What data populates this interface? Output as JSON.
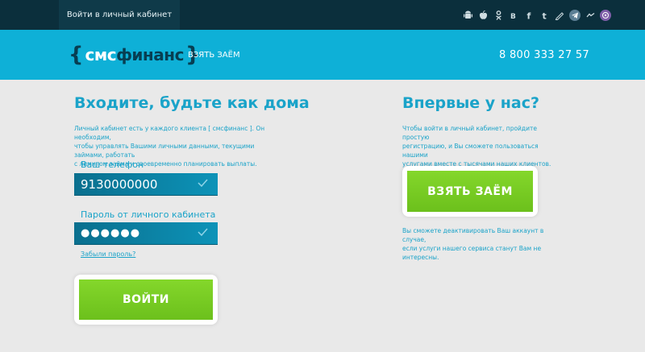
{
  "topbar": {
    "login_tab": "Войти в личный кабинет",
    "social": [
      {
        "name": "android-icon",
        "glyph": "🤖"
      },
      {
        "name": "apple-icon",
        "glyph": ""
      },
      {
        "name": "odnoklassniki-icon",
        "glyph": "ok"
      },
      {
        "name": "vk-icon",
        "glyph": "B"
      },
      {
        "name": "facebook-icon",
        "glyph": "f"
      },
      {
        "name": "twitter-icon",
        "glyph": "t"
      },
      {
        "name": "paperclip-icon",
        "glyph": "✎"
      },
      {
        "name": "telegram-icon",
        "glyph": "➤"
      },
      {
        "name": "messenger-icon",
        "glyph": "~"
      },
      {
        "name": "viber-icon",
        "glyph": "✆"
      }
    ]
  },
  "header": {
    "logo_open": "{",
    "logo_sms": "смс",
    "logo_fin": "финанс",
    "logo_close": "}",
    "nav_loan": "ВЗЯТЬ ЗАЁМ",
    "phone": "8 800 333 27 57"
  },
  "login": {
    "title": "Входите, будьте как дома",
    "description_lines": [
      "Личный кабинет есть у каждого клиента [ смсфинанс ]. Он необходим,",
      "чтобы управлять Вашими личными данными, текущими займами, работать",
      "с лимитом займа и своевременно планировать выплаты."
    ],
    "phone_label": "Ваш телефон",
    "phone_value": "9130000000",
    "password_label": "Пароль от личного кабинета",
    "password_value": "●●●●●●",
    "forgot": "Забыли пароль?",
    "submit": "ВОЙТИ"
  },
  "signup": {
    "title": "Впервые у нас?",
    "description_lines": [
      "Чтобы войти в личный кабинет, пройдите простую",
      "регистрацию, и Вы сможете пользоваться нашими",
      "услугами вместе с тысячами наших клиентов."
    ],
    "button": "ВЗЯТЬ ЗАЁМ",
    "note_lines": [
      "Вы сможете деактивировать Ваш аккаунт в случае,",
      "если услуги нашего сервиса станут Вам не",
      "интересны."
    ]
  },
  "colors": {
    "accent": "#0eb0d7",
    "dark": "#0b2f3c",
    "button_green": "#7ccf24",
    "text_blue": "#1aa3c9"
  }
}
